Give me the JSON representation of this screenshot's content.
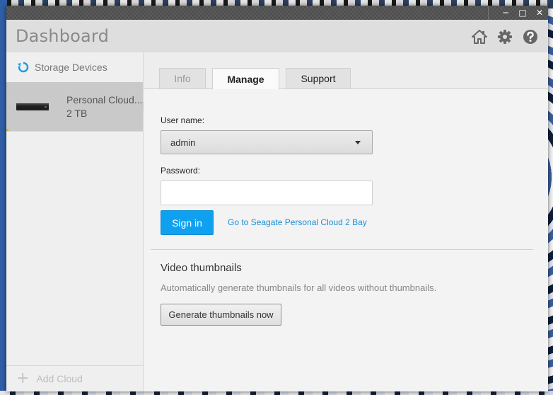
{
  "window": {
    "title": "Dashboard",
    "controls": {
      "minimize": "─",
      "maximize": "□",
      "close": "✕"
    }
  },
  "header_icons": [
    "home-icon",
    "gear-icon",
    "help-icon"
  ],
  "sidebar": {
    "header_label": "Storage Devices",
    "devices": [
      {
        "name": "Personal Cloud...",
        "size": "2 TB"
      }
    ],
    "add_label": "Add Cloud"
  },
  "tabs": [
    {
      "label": "Info",
      "active": false
    },
    {
      "label": "Manage",
      "active": true
    },
    {
      "label": "Support",
      "active": false
    }
  ],
  "manage": {
    "username_label": "User name:",
    "username_value": "admin",
    "password_label": "Password:",
    "password_value": "",
    "signin_label": "Sign in",
    "link_label": "Go to Seagate Personal Cloud 2 Bay"
  },
  "thumbnails": {
    "title": "Video thumbnails",
    "description": "Automatically generate thumbnails for all videos without thumbnails.",
    "button_label": "Generate thumbnails now"
  },
  "colors": {
    "accent": "#0fa1f0",
    "link": "#1a8fd6",
    "header_bg": "#dedede",
    "titlebar_bg": "#4a4a4a"
  }
}
